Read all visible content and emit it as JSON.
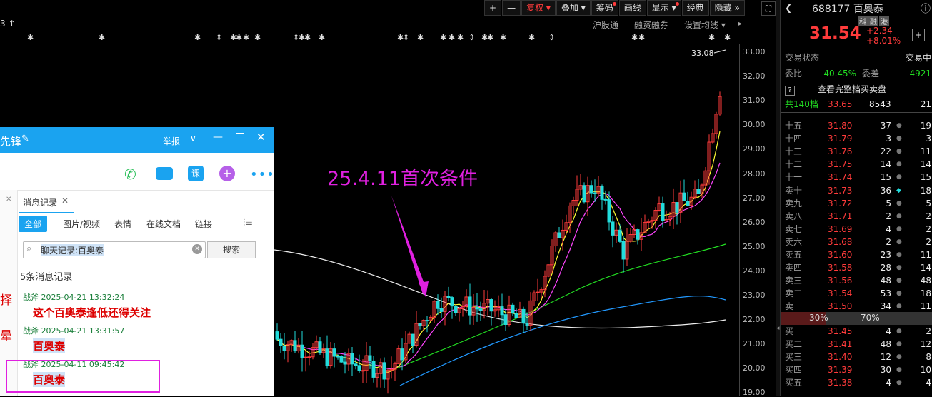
{
  "toolbar": {
    "items": [
      {
        "label": "+"
      },
      {
        "label": "—"
      },
      {
        "label": "复权 ▾",
        "active": true
      },
      {
        "label": "叠加 ▾"
      },
      {
        "label": "筹码",
        "dot": true
      },
      {
        "label": "画线"
      },
      {
        "label": "显示 ▾",
        "dot": true
      },
      {
        "label": "经典"
      },
      {
        "label": "隐藏 »"
      }
    ]
  },
  "subbar": [
    "沪股通",
    "融资融券",
    "设置均线 ▾"
  ],
  "top_left_mark": "3 ↑",
  "chart_label": {
    "price": "33.08"
  },
  "annotation": "25.4.11首次条件",
  "y_axis": [
    "33.00",
    "32.00",
    "31.00",
    "30.00",
    "29.00",
    "28.00",
    "27.00",
    "26.00",
    "25.00",
    "24.00",
    "23.00",
    "22.00",
    "21.00",
    "20.00",
    "19.00"
  ],
  "stock": {
    "code": "688177",
    "name": "百奥泰",
    "badges": [
      "科",
      "融",
      "港"
    ],
    "price": "31.54",
    "change": "+2.34",
    "pct": "+8.01%"
  },
  "trade_status": {
    "label": "交易状态",
    "value": "交易中"
  },
  "ratio": {
    "weibi_label": "委比",
    "weibi": "-40.45%",
    "weicha_label": "委差",
    "weicha": "-4921"
  },
  "full_book": "查看完整档买卖盘",
  "total": {
    "label": "共140档",
    "price": "33.65",
    "vol": "8543",
    "extra": "21"
  },
  "asks": [
    {
      "label": "十五",
      "price": "31.80",
      "vol": "37",
      "extra": "19"
    },
    {
      "label": "十四",
      "price": "31.79",
      "vol": "3",
      "extra": "3"
    },
    {
      "label": "十三",
      "price": "31.76",
      "vol": "22",
      "extra": "11"
    },
    {
      "label": "十二",
      "price": "31.75",
      "vol": "14",
      "extra": "14"
    },
    {
      "label": "十一",
      "price": "31.74",
      "vol": "15",
      "extra": "15"
    },
    {
      "label": "卖十",
      "price": "31.73",
      "vol": "36",
      "extra": "18"
    },
    {
      "label": "卖九",
      "price": "31.72",
      "vol": "5",
      "extra": "5"
    },
    {
      "label": "卖八",
      "price": "31.71",
      "vol": "2",
      "extra": "2"
    },
    {
      "label": "卖七",
      "price": "31.69",
      "vol": "4",
      "extra": "2"
    },
    {
      "label": "卖六",
      "price": "31.68",
      "vol": "2",
      "extra": "2"
    },
    {
      "label": "卖五",
      "price": "31.60",
      "vol": "23",
      "extra": "11"
    },
    {
      "label": "卖四",
      "price": "31.58",
      "vol": "28",
      "extra": "14"
    },
    {
      "label": "卖三",
      "price": "31.56",
      "vol": "48",
      "extra": "48"
    },
    {
      "label": "卖二",
      "price": "31.54",
      "vol": "53",
      "extra": "18"
    },
    {
      "label": "卖一",
      "price": "31.50",
      "vol": "34",
      "extra": "11"
    }
  ],
  "ratio_bar": {
    "left": "30%",
    "right": "70%",
    "left_fraction": 0.3
  },
  "bids": [
    {
      "label": "买一",
      "price": "31.45",
      "vol": "4",
      "extra": "2"
    },
    {
      "label": "买二",
      "price": "31.41",
      "vol": "48",
      "extra": "12"
    },
    {
      "label": "买三",
      "price": "31.40",
      "vol": "12",
      "extra": "8"
    },
    {
      "label": "买四",
      "price": "31.39",
      "vol": "30",
      "extra": "10"
    },
    {
      "label": "买五",
      "price": "31.38",
      "vol": "4",
      "extra": "4"
    }
  ],
  "chat": {
    "title": "先锋",
    "report": "举报",
    "tab_record": "消息记录",
    "filters": [
      "全部",
      "图片/视频",
      "表情",
      "在线文档",
      "链接"
    ],
    "search_value": "聊天记录:百奥泰",
    "search_button": "搜索",
    "count": "5条消息记录",
    "messages": [
      {
        "meta": "战斧 2025-04-21 13:32:24",
        "text": "这个百奥泰逢低还得关注"
      },
      {
        "meta": "战斧 2025-04-21 13:31:57",
        "text": "百奥泰"
      },
      {
        "meta": "战斧 2025-04-11 09:45:42",
        "text": "百奥泰"
      }
    ],
    "side_chars": [
      "择",
      "晕"
    ]
  },
  "colors": {
    "up": "#ff3b3b",
    "down": "#22dddd",
    "ma5": "#ffff33",
    "ma10": "#ff44ff",
    "ma20": "#22dd22",
    "ma30": "#2299ff",
    "ma60": "#eeeeee",
    "annotation": "#e020e0",
    "chat_bar": "#1aa3f0"
  }
}
